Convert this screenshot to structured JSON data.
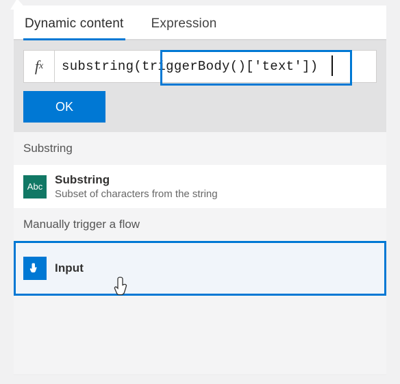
{
  "tabs": {
    "dynamic": "Dynamic content",
    "expression": "Expression"
  },
  "expression": {
    "value": "substring(triggerBody()['text'])",
    "ok_label": "OK"
  },
  "groups": {
    "substring": "Substring",
    "manual_trigger": "Manually trigger a flow"
  },
  "items": {
    "substring": {
      "title": "Substring",
      "desc": "Subset of characters from the string",
      "icon_text": "Abc"
    },
    "input": {
      "title": "Input"
    }
  }
}
